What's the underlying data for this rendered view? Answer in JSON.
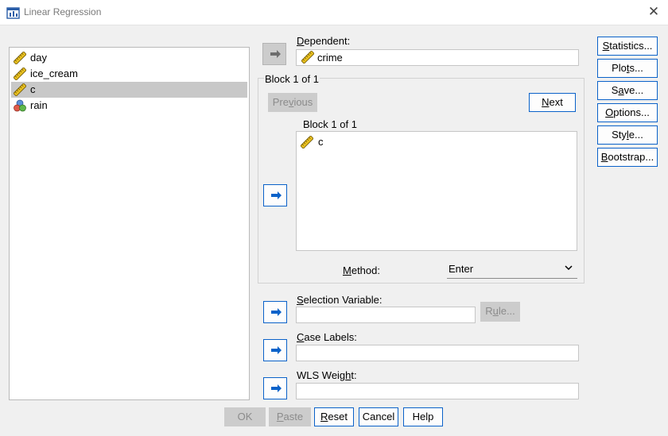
{
  "window": {
    "title": "Linear Regression"
  },
  "variables": [
    {
      "name": "day",
      "icon": "scale-ruler-icon",
      "selected": false
    },
    {
      "name": "ice_cream",
      "icon": "scale-ruler-icon",
      "selected": false
    },
    {
      "name": "c",
      "icon": "scale-ruler-icon",
      "selected": true
    },
    {
      "name": "rain",
      "icon": "nominal-circles-icon",
      "selected": false
    }
  ],
  "dependent": {
    "label_u": "D",
    "label_rest": "ependent:",
    "value": "crime"
  },
  "block": {
    "group_title": "Block 1 of 1",
    "inner_title": "Block 1 of 1",
    "previous_u": "v",
    "previous_pre": "Pre",
    "previous_post": "ious",
    "next_u": "N",
    "next_rest": "ext",
    "items": [
      "c"
    ]
  },
  "method": {
    "label_u": "M",
    "label_rest": "ethod:",
    "value": "Enter"
  },
  "selection": {
    "label_u": "S",
    "label_rest": "election Variable:",
    "value": "",
    "rule_u": "u",
    "rule_pre": "R",
    "rule_post": "le..."
  },
  "case_labels": {
    "label_u": "C",
    "label_rest": "ase Labels:",
    "value": ""
  },
  "wls": {
    "label_pre": "WLS Weig",
    "label_u": "h",
    "label_post": "t:",
    "value": ""
  },
  "side_buttons": [
    {
      "pre": "",
      "u": "S",
      "post": "tatistics..."
    },
    {
      "pre": "Plo",
      "u": "t",
      "post": "s..."
    },
    {
      "pre": "S",
      "u": "a",
      "post": "ve..."
    },
    {
      "pre": "",
      "u": "O",
      "post": "ptions..."
    },
    {
      "pre": "Sty",
      "u": "l",
      "post": "e..."
    },
    {
      "pre": "",
      "u": "B",
      "post": "ootstrap..."
    }
  ],
  "footer": {
    "ok": "OK",
    "paste_u": "P",
    "paste_rest": "aste",
    "reset_u": "R",
    "reset_rest": "eset",
    "cancel": "Cancel",
    "help": "Help"
  },
  "colors": {
    "accent": "#0a62c9",
    "selected_row": "#c8c8c8",
    "disabled_button": "#cccccc"
  }
}
